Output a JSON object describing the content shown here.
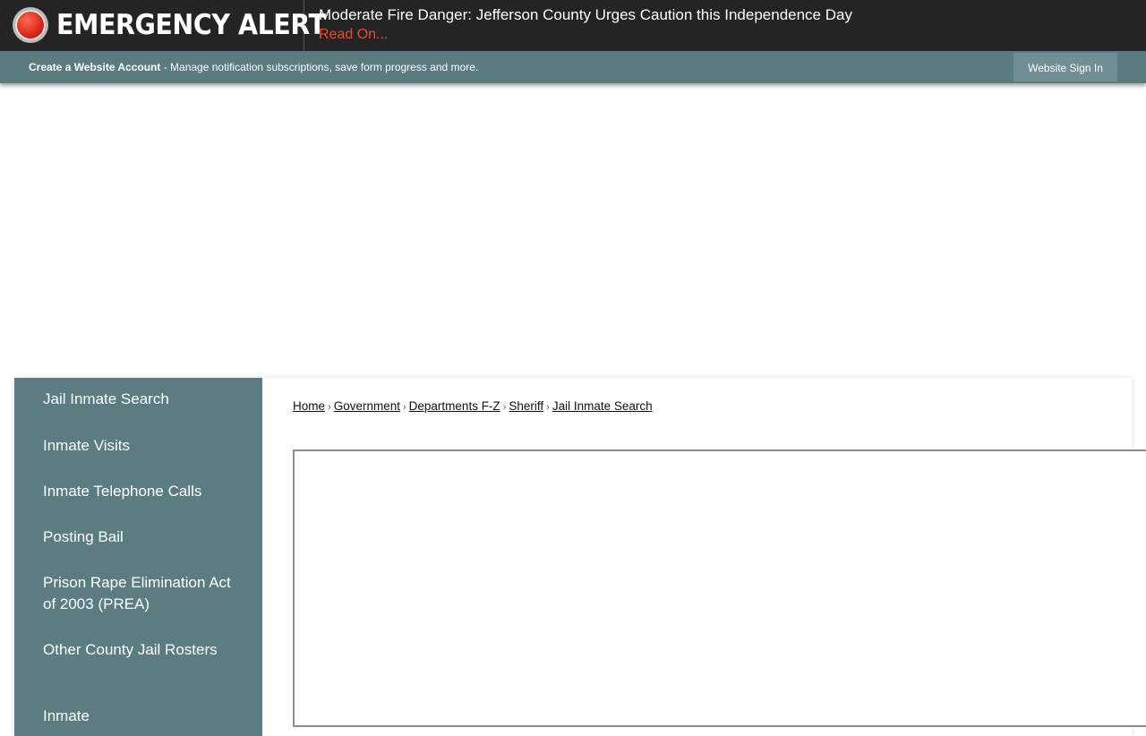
{
  "alert": {
    "label": "EMERGENCY ALERT",
    "message": "Moderate Fire Danger: Jefferson County Urges Caution this Independence Day",
    "link": "Read On..."
  },
  "account_bar": {
    "create_label": "Create a Website Account",
    "description": " - Manage notification subscriptions, save form progress and more.",
    "signin_label": "Website Sign In"
  },
  "side_nav": {
    "items": [
      {
        "label": "Jail Inmate Search"
      },
      {
        "label": "Inmate Visits"
      },
      {
        "label": "Inmate Telephone Calls"
      },
      {
        "label": "Posting Bail"
      },
      {
        "label": "Prison Rape Elimination Act of 2003 (PREA)"
      },
      {
        "label": "Other County Jail Rosters"
      },
      {
        "label": "Inmate"
      }
    ]
  },
  "breadcrumb": {
    "items": [
      "Home",
      "Government",
      "Departments F-Z",
      "Sheriff",
      "Jail Inmate Search"
    ],
    "separator": "›"
  },
  "colors": {
    "alert_bg": "#242424",
    "alert_link": "#e84a2e",
    "teal": "#5b7c80"
  }
}
